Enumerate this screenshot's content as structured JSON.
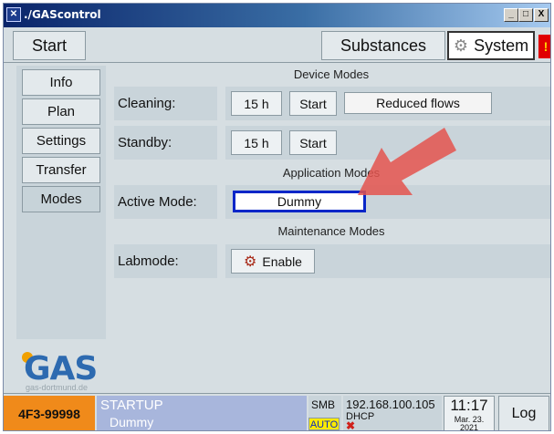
{
  "window": {
    "title": "./GAScontrol",
    "controls": {
      "minimize": "_",
      "restore": "□",
      "close": "X"
    }
  },
  "top_tabs": {
    "start": "Start",
    "substances": "Substances",
    "system": "System",
    "alert": "!"
  },
  "nav": {
    "items": [
      {
        "label": "Info"
      },
      {
        "label": "Plan"
      },
      {
        "label": "Settings"
      },
      {
        "label": "Transfer"
      },
      {
        "label": "Modes",
        "active": true
      }
    ]
  },
  "sections": {
    "device_modes": "Device Modes",
    "application_modes": "Application Modes",
    "maintenance_modes": "Maintenance Modes"
  },
  "cleaning": {
    "label": "Cleaning:",
    "hours": "15 h",
    "start": "Start",
    "flow": "Reduced flows"
  },
  "standby": {
    "label": "Standby:",
    "hours": "15 h",
    "start": "Start"
  },
  "active_mode": {
    "label": "Active Mode:",
    "value": "Dummy"
  },
  "labmode": {
    "label": "Labmode:",
    "button": "Enable"
  },
  "logo": {
    "text": "GAS",
    "subtitle": "gas-dortmund.de"
  },
  "status": {
    "device_id": "4F3-99998",
    "state": "STARTUP",
    "mode": "Dummy",
    "smb": "SMB",
    "auto": "AUTO",
    "ip": "192.168.100.105",
    "dhcp": "DHCP",
    "net_error_icon": "x-mark-icon",
    "time": "11:17",
    "date": "Mar. 23.",
    "year": "2021",
    "log": "Log"
  },
  "colors": {
    "orange_id": "#f08a1a",
    "active_border": "#0826c8",
    "alert_red": "#e00000",
    "arrow_red": "#e4534e"
  }
}
